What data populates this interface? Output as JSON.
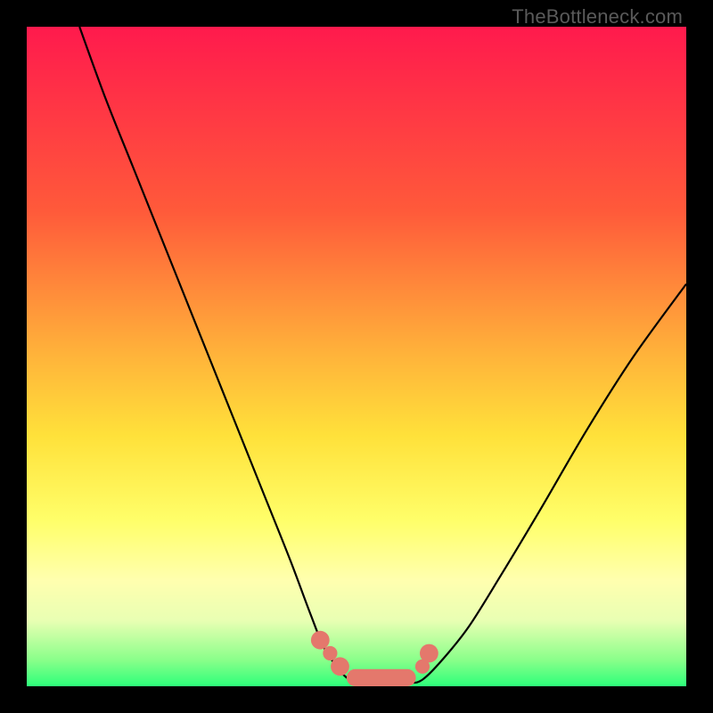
{
  "attribution": "TheBottleneck.com",
  "colors": {
    "frame": "#000000",
    "curve": "#000000",
    "marker": "#e4786c",
    "gradient_stops": [
      {
        "pct": 0,
        "hex": "#ff1a4d"
      },
      {
        "pct": 28,
        "hex": "#ff5a3a"
      },
      {
        "pct": 50,
        "hex": "#ffb43a"
      },
      {
        "pct": 62,
        "hex": "#ffe13a"
      },
      {
        "pct": 75,
        "hex": "#ffff6a"
      },
      {
        "pct": 84,
        "hex": "#ffffaf"
      },
      {
        "pct": 90,
        "hex": "#e9ffb3"
      },
      {
        "pct": 96,
        "hex": "#8aff8a"
      },
      {
        "pct": 100,
        "hex": "#2dff7a"
      }
    ]
  },
  "chart_data": {
    "type": "line",
    "title": "",
    "xlabel": "",
    "ylabel": "",
    "xlim": [
      0,
      100
    ],
    "ylim": [
      0,
      100
    ],
    "note": "Axes are unlabeled; values are estimated pixel-relative percentages. y=0 is the bottom (green), y=100 is the top (red). The curve is a V-shaped bottleneck plot.",
    "series": [
      {
        "name": "left-branch",
        "x": [
          8,
          12,
          16,
          20,
          24,
          28,
          32,
          36,
          40,
          43,
          45,
          47,
          49
        ],
        "y": [
          100,
          89,
          79,
          69,
          59,
          49,
          39,
          29,
          19,
          11,
          6,
          3,
          1
        ]
      },
      {
        "name": "flat-bottom",
        "x": [
          49,
          52,
          55,
          58,
          60
        ],
        "y": [
          1,
          0.5,
          0.5,
          0.5,
          1
        ]
      },
      {
        "name": "right-branch",
        "x": [
          60,
          63,
          67,
          72,
          78,
          85,
          92,
          100
        ],
        "y": [
          1,
          4,
          9,
          17,
          27,
          39,
          50,
          61
        ]
      }
    ],
    "markers": {
      "name": "highlighted-minimum-points",
      "shape": "circle",
      "color": "#e4786c",
      "x": [
        44.5,
        46,
        47.5,
        60,
        61
      ],
      "y": [
        7,
        5,
        3,
        3,
        5
      ],
      "r": [
        1.4,
        1.1,
        1.4,
        1.1,
        1.4
      ]
    },
    "pill": {
      "name": "flat-bottom-band",
      "color": "#e4786c",
      "x0": 48.5,
      "x1": 59,
      "y": 1.3,
      "h": 2.6
    }
  }
}
